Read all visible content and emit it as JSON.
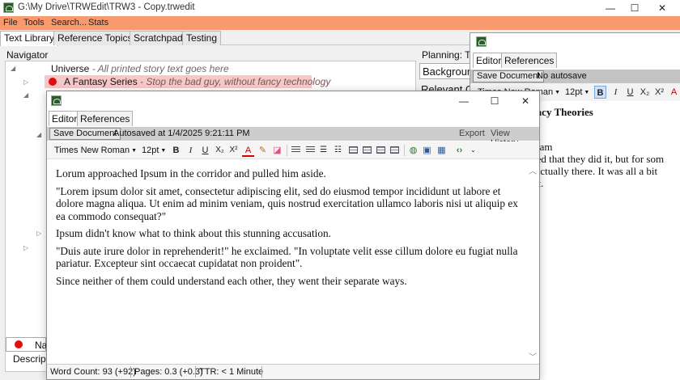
{
  "window": {
    "title": "G:\\My Drive\\TRWEdit\\TRW3 - Copy.trwedit",
    "minimize": "—",
    "maximize": "☐",
    "close": "✕"
  },
  "menu": [
    "File",
    "Tools",
    "Search...",
    "Stats"
  ],
  "tabs": [
    "Text Library",
    "Reference Topics",
    "Scratchpad",
    "Testing"
  ],
  "navigator": {
    "label": "Navigator",
    "rows": [
      {
        "title": "Universe",
        "desc": " - All printed story text goes here",
        "dot": false,
        "highlight": false
      },
      {
        "title": "A Fantasy Series",
        "desc": " - Stop the bad guy, without fancy technology",
        "dot": true,
        "highlight": true
      }
    ],
    "bottom_label": "Na",
    "descript_label": "Descript"
  },
  "planning": {
    "label": "Planning: T",
    "background_label": "Backgrour",
    "relevant_label": "Relevant C"
  },
  "right_editor": {
    "tabs": [
      "Editor",
      "References"
    ],
    "save_label": "Save Document",
    "autosave_text": "No autosave",
    "font": "Times New Roman",
    "size": "12pt",
    "heading": "spiracy Theories",
    "lines": [
      "d it?",
      "a dream",
      "eamed that they did it, but for som",
      "vas actually there. It was all a bit",
      "did it."
    ]
  },
  "editor": {
    "tabs": [
      "Editor",
      "References"
    ],
    "save_label": "Save Document",
    "autosave_text": "Autosaved at 1/4/2025 9:21:11 PM",
    "export_label": "Export",
    "history_label": "View History",
    "font": "Times New Roman",
    "size": "12pt",
    "paragraphs": [
      "Lorum approached Ipsum in the corridor and pulled him aside.",
      "\"Lorem ipsum dolor sit amet, consectetur adipiscing elit, sed do eiusmod tempor incididunt ut labore et dolore magna aliqua. Ut enim ad minim veniam, quis nostrud exercitation ullamco laboris nisi ut aliquip ex ea commodo consequat?\"",
      "Ipsum didn't know what to think about this stunning accusation.",
      "\"Duis aute irure dolor in reprehenderit!\" he exclaimed.  \"In voluptate velit esse cillum dolore eu fugiat nulla pariatur. Excepteur sint occaecat cupidatat non proident\".",
      "Since neither of them could understand each other, they went their separate ways."
    ],
    "status": {
      "word_count": "Word Count:  93 (+92)",
      "pages": "Pages:  0.3 (+0.3)",
      "ttr": "TTR:  < 1 Minute"
    }
  },
  "colors": {
    "menubar": "#f89a6e",
    "highlight_row": "#f8c8c8",
    "red_dot": "#e01010"
  }
}
